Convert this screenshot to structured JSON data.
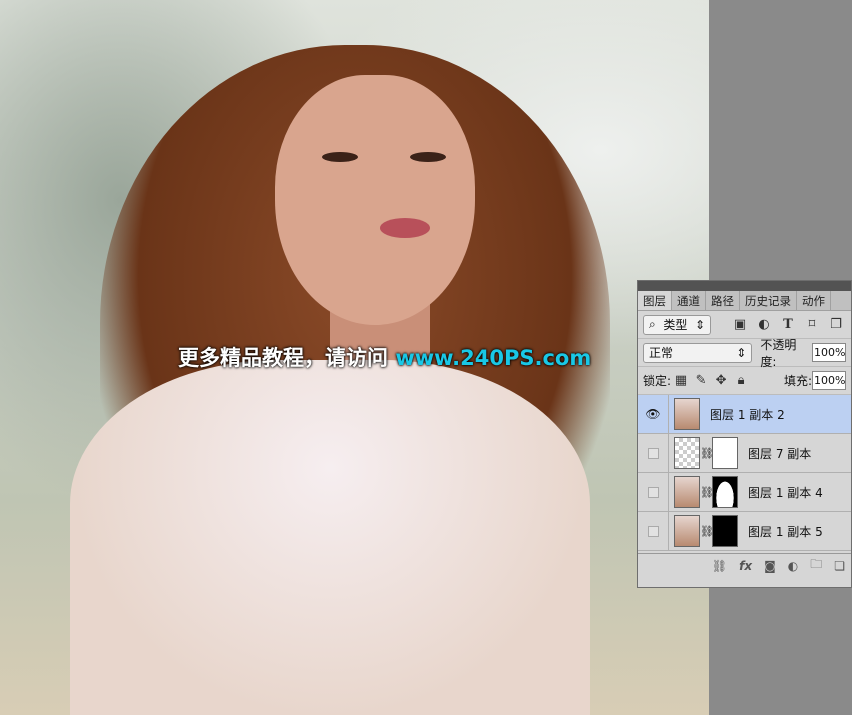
{
  "watermark": {
    "text": "更多精品教程，请访问",
    "url": "www.240PS.com"
  },
  "panel": {
    "tabs": [
      "图层",
      "通道",
      "路径",
      "历史记录",
      "动作"
    ],
    "filter": {
      "label": "类型",
      "icon": "search-icon"
    },
    "filter_icons": [
      "image-icon",
      "adjustment-icon",
      "type-icon",
      "shape-icon",
      "smart-object-icon"
    ],
    "blend_mode": "正常",
    "opacity_label": "不透明度:",
    "opacity": "100%",
    "lock_label": "锁定:",
    "fill_label": "填充:",
    "fill": "100%",
    "layers": [
      {
        "name": "图层 1 副本 2",
        "visible": true,
        "selected": true
      },
      {
        "name": "图层 7 副本",
        "visible": false
      },
      {
        "name": "图层 1 副本 4",
        "visible": false
      },
      {
        "name": "图层 1 副本 5",
        "visible": false
      }
    ],
    "bottom_icons": [
      "link-icon",
      "fx-icon",
      "mask-icon",
      "adjustment-layer-icon",
      "group-icon",
      "new-layer-icon"
    ]
  }
}
